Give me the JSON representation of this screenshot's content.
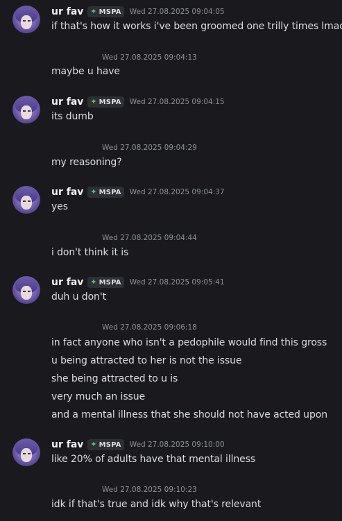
{
  "author": {
    "username": "ur fav",
    "tag_label": "MSPA",
    "tag_icon": "diamond-sparkle-icon",
    "tag_icon_color": "#5ac26b"
  },
  "messages": [
    {
      "timestamp": "Wed 27.08.2025 09:04:05",
      "lines": [
        "if that's how it works i've been groomed one trilly times lmao"
      ]
    },
    {
      "timestamp": "Wed 27.08.2025 09:04:13",
      "lines": [
        "maybe u have"
      ]
    },
    {
      "timestamp": "Wed 27.08.2025 09:04:15",
      "lines": [
        "its dumb"
      ]
    },
    {
      "timestamp": "Wed 27.08.2025 09:04:29",
      "lines": [
        "my reasoning?"
      ]
    },
    {
      "timestamp": "Wed 27.08.2025 09:04:37",
      "lines": [
        "yes"
      ]
    },
    {
      "timestamp": "Wed 27.08.2025 09:04:44",
      "lines": [
        "i don't think it is"
      ]
    },
    {
      "timestamp": "Wed 27.08.2025 09:05:41",
      "lines": [
        "duh u don't"
      ]
    },
    {
      "timestamp": "Wed 27.08.2025 09:06:18",
      "lines": [
        "in fact anyone who isn't a pedophile would find this gross",
        "u being attracted to her is not the issue",
        "she being attracted to u is",
        "very much an issue",
        "and a mental illness that she should not have acted upon"
      ]
    },
    {
      "timestamp": "Wed 27.08.2025 09:10:00",
      "lines": [
        "like 20% of adults have that mental illness"
      ]
    },
    {
      "timestamp": "Wed 27.08.2025 09:10:23",
      "lines": [
        "idk if that's true and idk why that's relevant"
      ]
    }
  ],
  "colors": {
    "background": "#1a1a1e",
    "text": "#dbdee1",
    "username": "#f2f3f5",
    "timestamp": "#8e9297"
  }
}
